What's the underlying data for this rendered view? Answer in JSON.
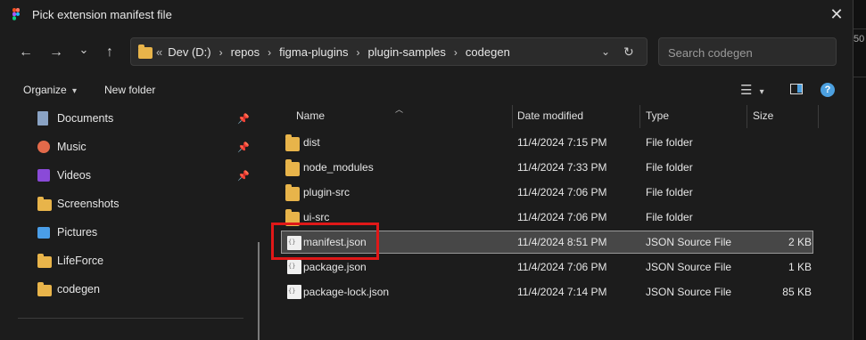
{
  "window": {
    "title": "Pick extension manifest file",
    "close_glyph": "✕"
  },
  "nav": {
    "back_glyph": "←",
    "forward_glyph": "→",
    "recent_glyph": "⌄",
    "up_glyph": "↑",
    "breadcrumb_overflow": "«",
    "breadcrumbs": [
      "Dev (D:)",
      "repos",
      "figma-plugins",
      "plugin-samples",
      "codegen"
    ],
    "sep_glyph": "›",
    "dropdown_glyph": "⌄",
    "refresh_glyph": "↻"
  },
  "search": {
    "placeholder": "Search codegen"
  },
  "toolbar": {
    "organize_label": "Organize",
    "organize_caret": "▾",
    "new_folder_label": "New folder",
    "view_glyph": "☰",
    "view_caret": "▾",
    "preview_pane_glyph": "◨",
    "help_glyph": "?"
  },
  "sidebar": {
    "pin_glyph": "📌",
    "items": [
      {
        "label": "Documents",
        "icon": "documents-icon",
        "pinned": true
      },
      {
        "label": "Music",
        "icon": "music-icon",
        "pinned": true
      },
      {
        "label": "Videos",
        "icon": "videos-icon",
        "pinned": true
      },
      {
        "label": "Screenshots",
        "icon": "folder-icon",
        "pinned": false
      },
      {
        "label": "Pictures",
        "icon": "pictures-icon",
        "pinned": false
      },
      {
        "label": "LifeForce",
        "icon": "folder-icon",
        "pinned": false
      },
      {
        "label": "codegen",
        "icon": "folder-icon",
        "pinned": false
      }
    ]
  },
  "columns": {
    "name": "Name",
    "date_modified": "Date modified",
    "type": "Type",
    "size": "Size",
    "sort_glyph": "︿"
  },
  "files": [
    {
      "name": "dist",
      "date": "11/4/2024 7:15 PM",
      "type": "File folder",
      "size": "",
      "icon": "folder-icon"
    },
    {
      "name": "node_modules",
      "date": "11/4/2024 7:33 PM",
      "type": "File folder",
      "size": "",
      "icon": "folder-icon"
    },
    {
      "name": "plugin-src",
      "date": "11/4/2024 7:06 PM",
      "type": "File folder",
      "size": "",
      "icon": "folder-icon"
    },
    {
      "name": "ui-src",
      "date": "11/4/2024 7:06 PM",
      "type": "File folder",
      "size": "",
      "icon": "folder-icon"
    },
    {
      "name": "manifest.json",
      "date": "11/4/2024 8:51 PM",
      "type": "JSON Source File",
      "size": "2 KB",
      "icon": "json-file-icon",
      "selected": true
    },
    {
      "name": "package.json",
      "date": "11/4/2024 7:06 PM",
      "type": "JSON Source File",
      "size": "1 KB",
      "icon": "json-file-icon"
    },
    {
      "name": "package-lock.json",
      "date": "11/4/2024 7:14 PM",
      "type": "JSON Source File",
      "size": "85 KB",
      "icon": "json-file-icon"
    }
  ],
  "background": {
    "number_fragment": "50"
  },
  "colors": {
    "folder": "#e8b44a",
    "highlight": "#e01818",
    "selected_row": "#474747",
    "accent": "#4ca0e0"
  }
}
